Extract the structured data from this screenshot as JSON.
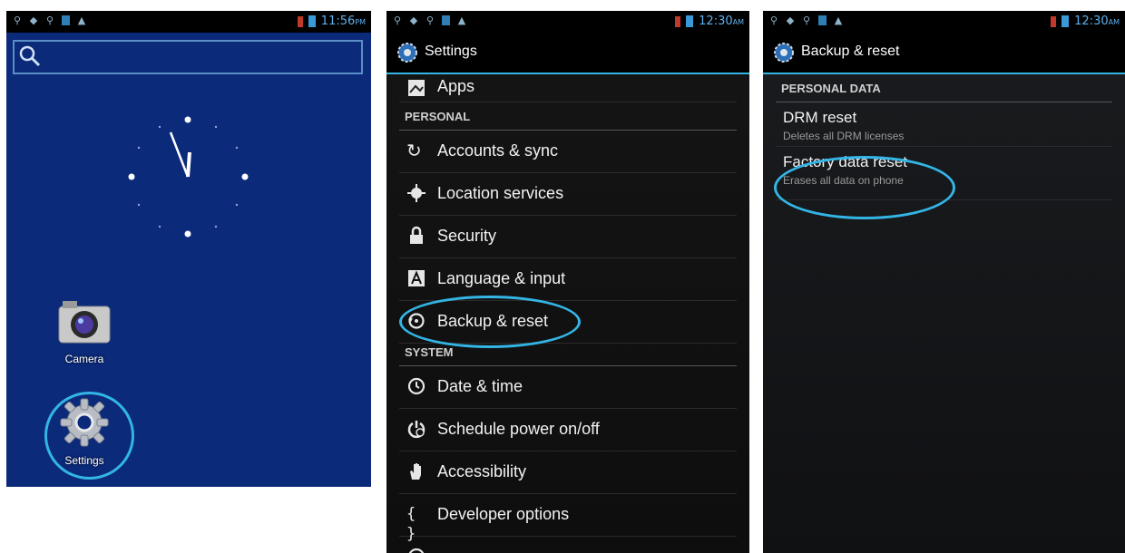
{
  "screens": {
    "home": {
      "status_time": "11:56",
      "status_ampm": "PM",
      "apps": [
        {
          "label": "Camera",
          "icon": "camera-icon"
        },
        {
          "label": "Settings",
          "icon": "gear-icon"
        }
      ]
    },
    "settings": {
      "status_time": "12:30",
      "status_ampm": "AM",
      "title": "Settings",
      "top_item": "Apps",
      "section_personal": "PERSONAL",
      "personal_items": [
        "Accounts & sync",
        "Location services",
        "Security",
        "Language & input",
        "Backup & reset"
      ],
      "section_system": "SYSTEM",
      "system_items": [
        "Date & time",
        "Schedule power on/off",
        "Accessibility",
        "Developer options"
      ]
    },
    "backup": {
      "status_time": "12:30",
      "status_ampm": "AM",
      "title": "Backup & reset",
      "section": "PERSONAL DATA",
      "items": [
        {
          "title": "DRM reset",
          "subtitle": "Deletes all DRM licenses"
        },
        {
          "title": "Factory data reset",
          "subtitle": "Erases all data on phone"
        }
      ]
    }
  },
  "accent_color": "#33b5e5",
  "home_background": "#0b2a7a"
}
